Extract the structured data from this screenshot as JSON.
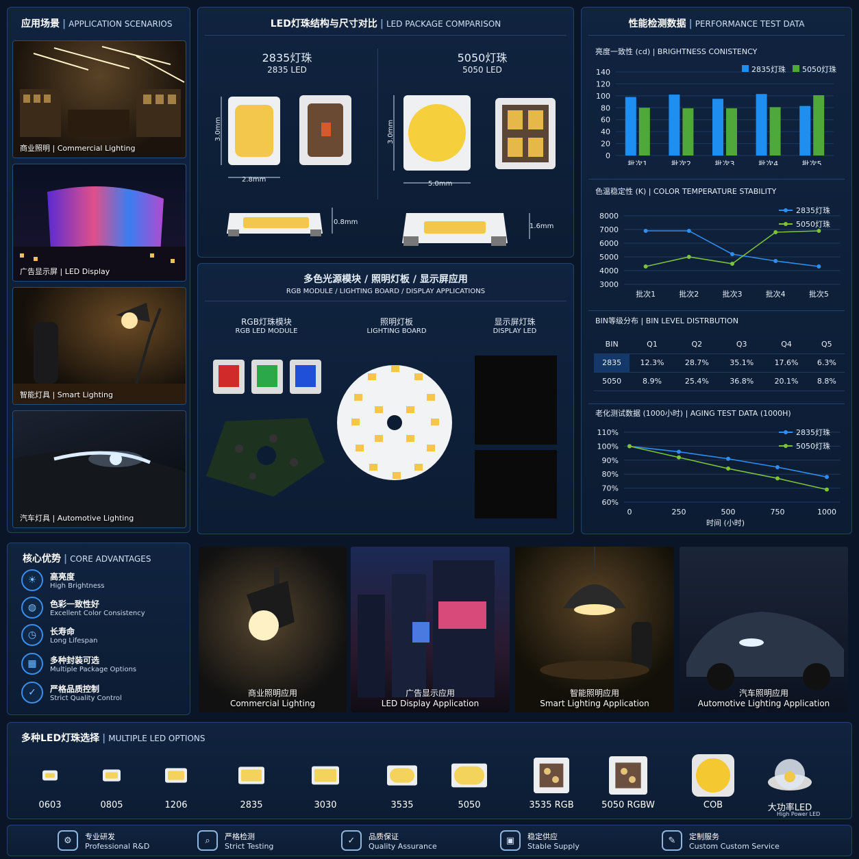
{
  "scenarios": {
    "title_cn": "应用场景",
    "title_en": "APPLICATION SCENARIOS",
    "items": [
      {
        "label": "商业照明 | Commercial Lighting"
      },
      {
        "label": "广告显示屏 | LED Display"
      },
      {
        "label": "智能灯具 | Smart Lighting"
      },
      {
        "label": "汽车灯具 | Automotive Lighting"
      }
    ]
  },
  "package": {
    "title_cn": "LED灯珠结构与尺寸对比",
    "title_en": "LED PACKAGE COMPARISON",
    "left": {
      "name_cn": "2835灯珠",
      "name_en": "2835 LED",
      "height": "3.0mm",
      "width": "2.8mm",
      "thick": "0.8mm"
    },
    "right": {
      "name_cn": "5050灯珠",
      "name_en": "5050 LED",
      "height": "3.0mm",
      "width": "5.0mm",
      "thick": "1.6mm"
    }
  },
  "modules": {
    "title_cn": "多色光源模块 / 照明灯板 / 显示屏应用",
    "title_en": "RGB MODULE / LIGHTING BOARD / DISPLAY APPLICATIONS",
    "cols": [
      {
        "cn": "RGB灯珠模块",
        "en": "RGB LED MODULE"
      },
      {
        "cn": "照明灯板",
        "en": "LIGHTING BOARD"
      },
      {
        "cn": "显示屏灯珠",
        "en": "DISPLAY LED"
      }
    ]
  },
  "perf": {
    "title_cn": "性能检测数据",
    "title_en": "PERFORMANCE TEST DATA",
    "brightness_title": "亮度一致性 (cd) | BRIGHTNESS CONISTENCY",
    "color_title": "色温稳定性 (K) | COLOR TEMPERATURE STABILITY",
    "bin_title": "BIN等级分布 | BIN LEVEL DISTRBUTION",
    "aging_title": "老化测试数据 (1000小时) | AGING TEST DATA (1000H)",
    "aging_xlabel": "时间 (小时)"
  },
  "chart_data": [
    {
      "type": "bar",
      "categories": [
        "批次1",
        "批次2",
        "批次3",
        "批次4",
        "批次5"
      ],
      "ylim": [
        0,
        140
      ],
      "yticks": [
        0,
        20,
        40,
        60,
        80,
        100,
        120,
        140
      ],
      "series": [
        {
          "name": "2835灯珠",
          "values": [
            98,
            102,
            95,
            103,
            83
          ],
          "color": "#1e8ff0"
        },
        {
          "name": "5050灯珠",
          "values": [
            80,
            79,
            79,
            81,
            101
          ],
          "color": "#4fa83a"
        }
      ]
    },
    {
      "type": "line",
      "categories": [
        "批次1",
        "批次2",
        "批次3",
        "批次4",
        "批次5"
      ],
      "ylim": [
        3000,
        8000
      ],
      "yticks": [
        3000,
        4000,
        5000,
        6000,
        7000,
        8000
      ],
      "series": [
        {
          "name": "2835灯珠",
          "values": [
            6900,
            6900,
            5200,
            4700,
            4300
          ],
          "color": "#2f8ef0"
        },
        {
          "name": "5050灯珠",
          "values": [
            4300,
            5000,
            4500,
            6800,
            6900
          ],
          "color": "#7cc23a"
        }
      ]
    },
    {
      "type": "table",
      "columns": [
        "BIN",
        "Q1",
        "Q2",
        "Q3",
        "Q4",
        "Q5"
      ],
      "rows": [
        [
          "2835",
          "12.3%",
          "28.7%",
          "35.1%",
          "17.6%",
          "6.3%"
        ],
        [
          "5050",
          "8.9%",
          "25.4%",
          "36.8%",
          "20.1%",
          "8.8%"
        ]
      ]
    },
    {
      "type": "line",
      "x": [
        0,
        250,
        500,
        750,
        1000
      ],
      "xticks": [
        "0",
        "250",
        "500",
        "750",
        "1000"
      ],
      "ylim": [
        60,
        110
      ],
      "yticks": [
        "60%",
        "70%",
        "80%",
        "90%",
        "100%",
        "110%"
      ],
      "series": [
        {
          "name": "2835灯珠",
          "values": [
            100,
            96,
            91,
            85,
            78
          ],
          "color": "#2f8ef0"
        },
        {
          "name": "5050灯珠",
          "values": [
            100,
            92,
            84,
            77,
            69
          ],
          "color": "#7cc23a"
        }
      ]
    }
  ],
  "advantages": {
    "title_cn": "核心优势",
    "title_en": "CORE ADVANTAGES",
    "items": [
      {
        "cn": "高亮度",
        "en": "High Brightness",
        "icon": "sun-icon"
      },
      {
        "cn": "色彩一致性好",
        "en": "Excellent Color Consistency",
        "icon": "color-wheel-icon"
      },
      {
        "cn": "长寿命",
        "en": "Long Lifespan",
        "icon": "clock-icon"
      },
      {
        "cn": "多种封装可选",
        "en": "Multiple Package Options",
        "icon": "grid-icon"
      },
      {
        "cn": "严格品质控制",
        "en": "Strict Quality Control",
        "icon": "shield-icon"
      }
    ]
  },
  "apps": [
    {
      "cn": "商业照明应用",
      "en": "Commercial Lighting"
    },
    {
      "cn": "广告显示应用",
      "en": "LED Display Application"
    },
    {
      "cn": "智能照明应用",
      "en": "Smart Lighting Application"
    },
    {
      "cn": "汽车照明应用",
      "en": "Automotive Lighting Application"
    }
  ],
  "options": {
    "title_cn": "多种LED灯珠选择",
    "title_en": "MULTIPLE LED OPTIONS",
    "items": [
      "0603",
      "0805",
      "1206",
      "2835",
      "3030",
      "3535",
      "5050",
      "3535 RGB",
      "5050 RGBW",
      "COB",
      "大功率LED"
    ],
    "hp_en": "High Power LED"
  },
  "footer": [
    {
      "cn": "专业研发",
      "en": "Professional R&D"
    },
    {
      "cn": "严格检测",
      "en": "Strict Testing"
    },
    {
      "cn": "品质保证",
      "en": "Quality Assurance"
    },
    {
      "cn": "稳定供应",
      "en": "Stable Supply"
    },
    {
      "cn": "定制服务",
      "en": "Custom Custom Service"
    }
  ]
}
